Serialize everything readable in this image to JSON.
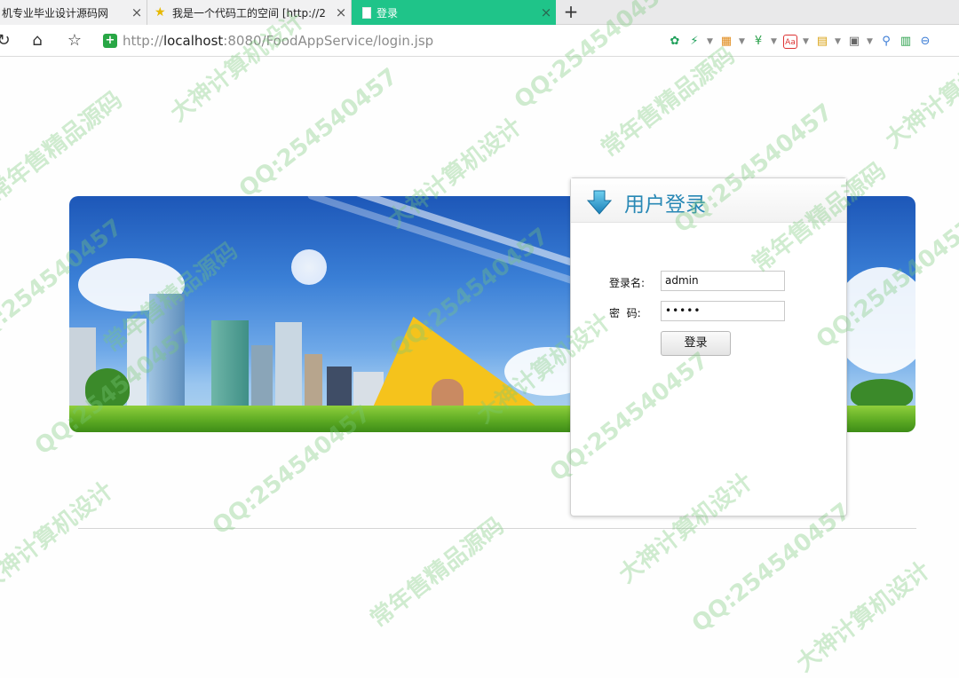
{
  "browser": {
    "tabs": [
      {
        "label": "机专业毕业设计源码网",
        "active": false
      },
      {
        "label": "我是一个代码工的空间 [http://2",
        "active": false
      },
      {
        "label": "登录",
        "active": true
      }
    ],
    "new_tab_label": "+",
    "close_label": "×",
    "url": {
      "scheme": "http://",
      "host": "localhost",
      "rest": ":8080/FoodAppService/login.jsp"
    },
    "accent_tab_color": "#1fc489"
  },
  "login": {
    "title": "用户登录",
    "username_label": "登录名:",
    "username_value": "admin",
    "password_label": "密  码:",
    "password_value": "•••••",
    "submit_label": "登录"
  },
  "watermarks": [
    "大神计算机设计",
    "QQ:254540457",
    "常年售精品源码",
    "QQ:254540457",
    "大神计算机设计",
    "常年售精品源码",
    "QQ:254540457",
    "大神计算机设计",
    "常年售精品源码",
    "QQ:254540457",
    "大神计算机设计",
    "QQ:254540457"
  ]
}
